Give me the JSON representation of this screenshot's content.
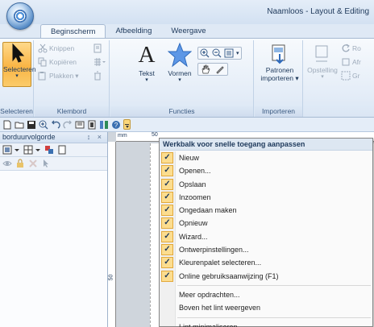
{
  "window": {
    "title": "Naamloos - Layout & Editing"
  },
  "tabs": [
    "Beginscherm",
    "Afbeelding",
    "Weergave"
  ],
  "ribbon": {
    "selecteren_label": "Selecteren",
    "knippen": "Knippen",
    "kopieren": "Kopiëren",
    "plakken": "Plakken",
    "tekst": "Tekst",
    "vormen": "Vormen",
    "patronen_line1": "Patronen",
    "patronen_line2": "importeren",
    "opstelling": "Opstelling",
    "ro": "Ro",
    "afr": "Afr",
    "gr": "Gr",
    "groups": {
      "selecteren": "Selecteren",
      "klembord": "Klembord",
      "functies": "Functies",
      "importeren": "Importeren"
    }
  },
  "panel": {
    "title": "borduurvolgorde",
    "controls": "↕ ×"
  },
  "ruler": {
    "top_label": "50",
    "unit": "mm",
    "left_label": "50"
  },
  "menu": {
    "title": "Werkbalk voor snelle toegang aanpassen",
    "checked_items": [
      "Nieuw",
      "Openen...",
      "Opslaan",
      "Inzoomen",
      "Ongedaan maken",
      "Opnieuw",
      "Wizard...",
      "Ontwerpinstellingen...",
      "Kleurenpalet selecteren...",
      "Online gebruiksaanwijzing (F1)"
    ],
    "more": "Meer opdrachten...",
    "above_ribbon": "Boven het lint weergeven",
    "minimize": "Lint minimaliseren"
  },
  "colors": {
    "accent": "#f9b545",
    "ribbon_border": "#a7bad2"
  },
  "icons": [
    "app-orb-icon",
    "arrow-select-icon",
    "scissors-icon",
    "copy-icon",
    "paste-icon",
    "text-icon",
    "star-shape-icon",
    "zoom-in-icon",
    "zoom-out-icon",
    "hand-icon",
    "import-icon",
    "new-icon",
    "open-icon",
    "save-icon",
    "undo-icon",
    "redo-icon",
    "help-icon",
    "checkmark-icon"
  ]
}
